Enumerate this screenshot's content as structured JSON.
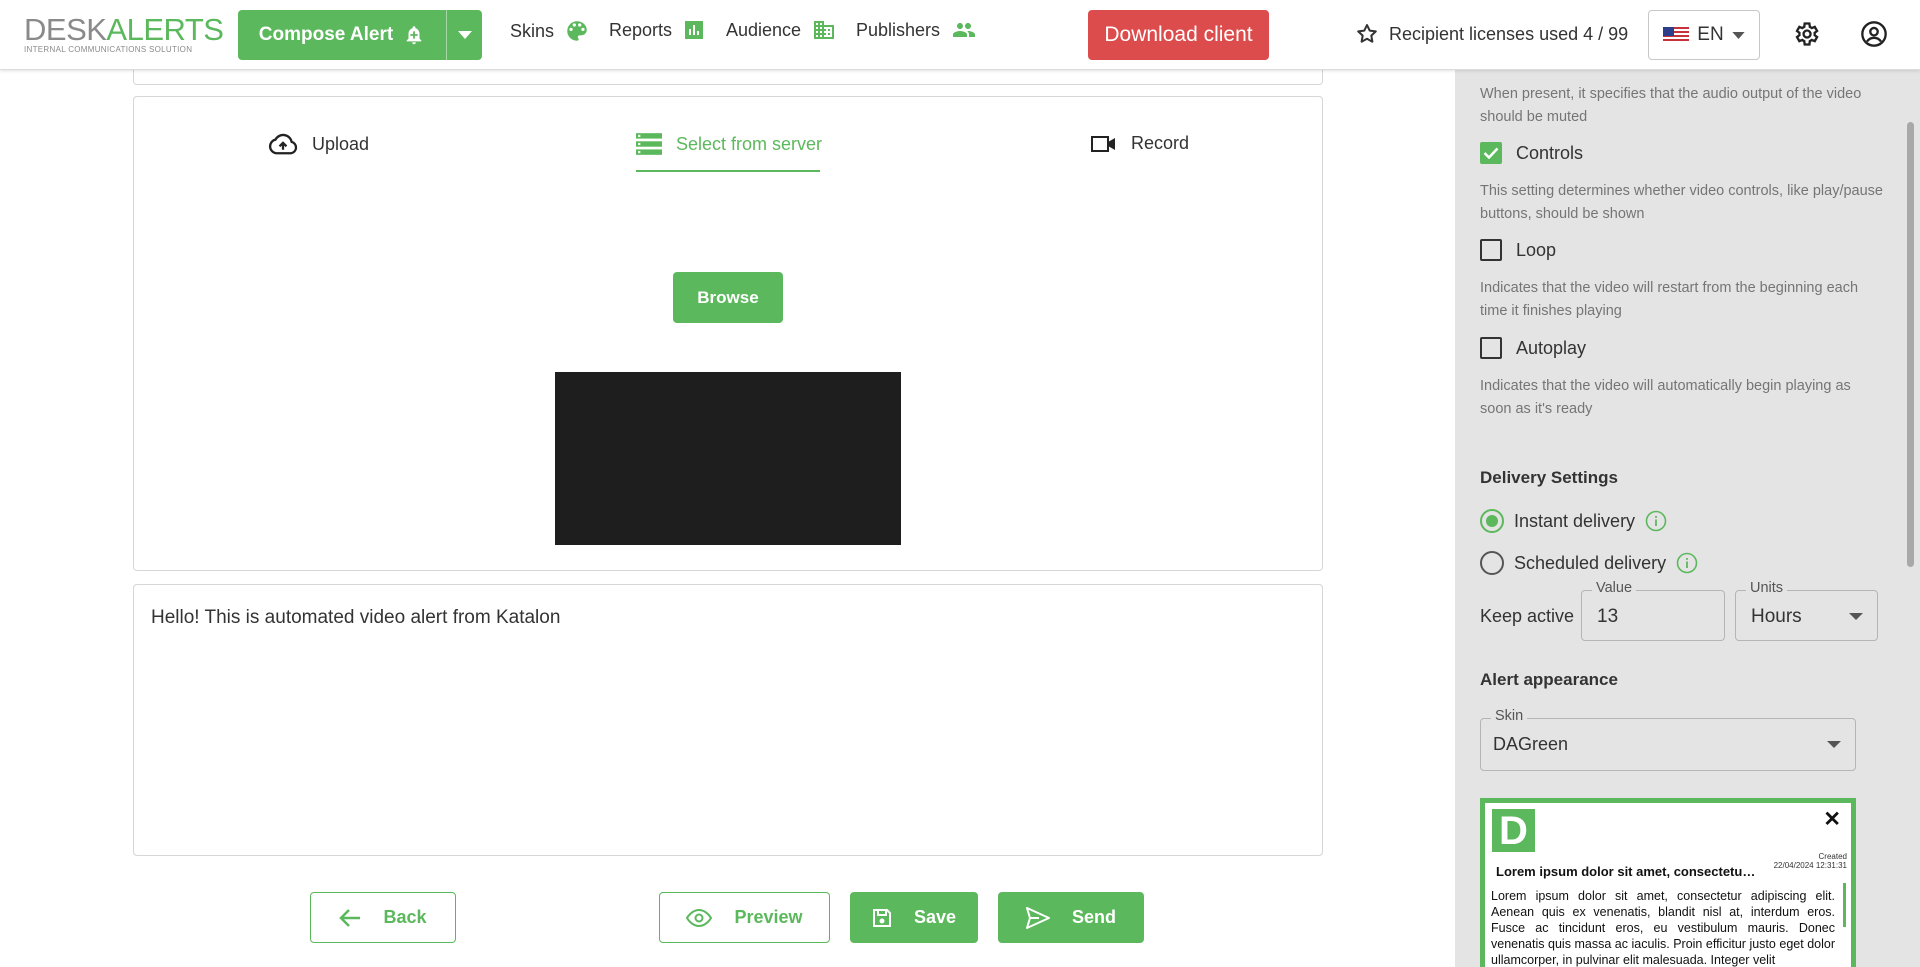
{
  "header": {
    "logo_desk": "DESK",
    "logo_alerts": "ALERTS",
    "logo_tagline": "INTERNAL COMMUNICATIONS SOLUTION",
    "compose_label": "Compose Alert",
    "nav": [
      {
        "label": "Skins",
        "icon": "palette-icon"
      },
      {
        "label": "Reports",
        "icon": "bar-chart-icon"
      },
      {
        "label": "Audience",
        "icon": "building-icon"
      },
      {
        "label": "Publishers",
        "icon": "people-icon"
      }
    ],
    "download_label": "Download client",
    "licenses_label": "Recipient licenses used 4 / 99",
    "language": "EN"
  },
  "media": {
    "tabs": [
      {
        "label": "Upload",
        "icon": "cloud-upload-icon"
      },
      {
        "label": "Select from server",
        "icon": "server-icon",
        "active": true
      },
      {
        "label": "Record",
        "icon": "videocam-icon"
      }
    ],
    "browse_label": "Browse"
  },
  "alert_text": "Hello! This is automated video alert from Katalon",
  "actions": {
    "back": "Back",
    "preview": "Preview",
    "save": "Save",
    "send": "Send"
  },
  "side": {
    "muted_desc": "When present, it specifies that the audio output of the video should be muted",
    "controls": {
      "label": "Controls",
      "checked": true,
      "desc": "This setting determines whether video controls, like play/pause buttons, should be shown"
    },
    "loop": {
      "label": "Loop",
      "checked": false,
      "desc": "Indicates that the video will restart from the beginning each time it finishes playing"
    },
    "autoplay": {
      "label": "Autoplay",
      "checked": false,
      "desc": "Indicates that the video will automatically begin playing as soon as it's ready"
    },
    "delivery_title": "Delivery Settings",
    "instant_label": "Instant delivery",
    "scheduled_label": "Scheduled delivery",
    "delivery_selected": "Instant delivery",
    "keep_active_label": "Keep active",
    "value_label": "Value",
    "value": "13",
    "units_label": "Units",
    "units": "Hours",
    "appearance_title": "Alert appearance",
    "skin_label": "Skin",
    "skin_value": "DAGreen",
    "preview": {
      "logo_letter": "D",
      "close": "✕",
      "created_label": "Created",
      "created_date": "22/04/2024 12:31:31",
      "title": "Lorem ipsum dolor sit amet, consectetur adipiscing",
      "body": "Lorem ipsum dolor sit amet, consectetur adipiscing elit. Aenean quis ex venenatis, blandit nisl at, interdum eros. Fusce ac tincidunt eros, eu vestibulum mauris. Donec venenatis quis massa ac iaculis. Proin efficitur justo eget dolor ullamcorper, in pulvinar elit malesuada. Integer velit"
    }
  },
  "colors": {
    "accent": "#5cb85c",
    "danger": "#dc4c4c",
    "panel": "#e4e4e4"
  }
}
